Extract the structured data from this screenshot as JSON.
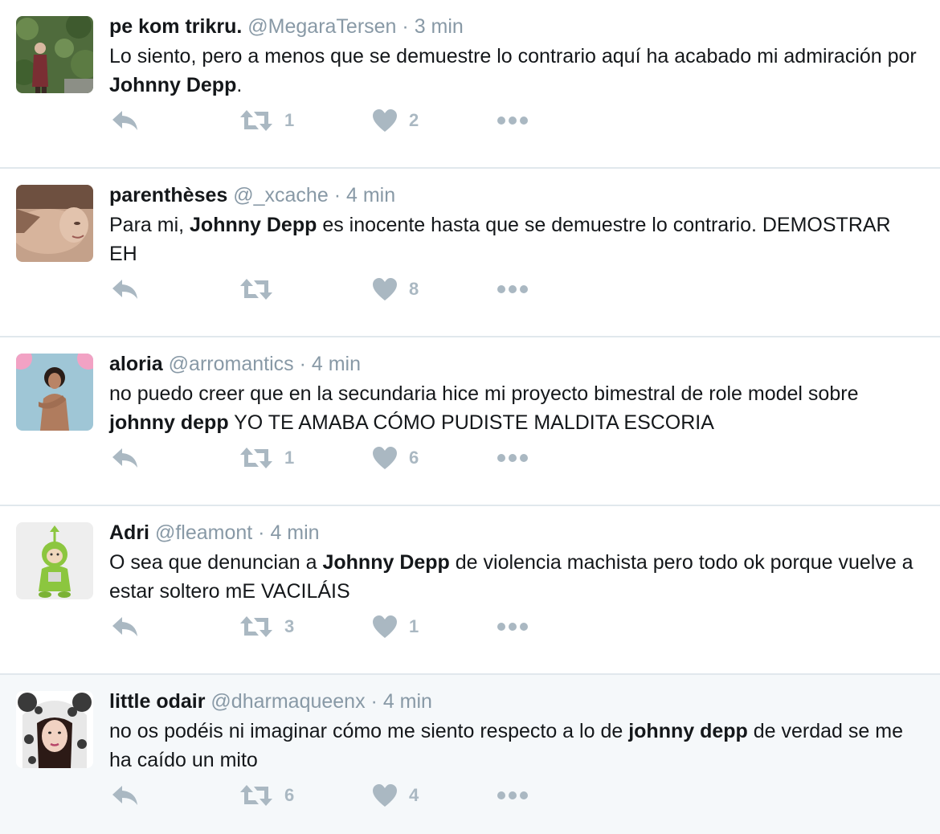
{
  "colors": {
    "icon": "#aab8c2",
    "muted": "#8899a6",
    "text": "#14171a",
    "divider": "#e1e8ed",
    "highlight_bg": "#f5f8fa"
  },
  "icons": {
    "reply": "reply-icon",
    "retweet": "retweet-icon",
    "like": "heart-icon",
    "more": "more-dots-icon"
  },
  "tweets": [
    {
      "name": "pe kom trikru.",
      "handle": "@MegaraTersen",
      "separator": "·",
      "time": "3 min",
      "text_before": "Lo siento, pero a menos que se demuestre lo contrario aquí ha acabado mi admiración por ",
      "text_bold": "Johnny Depp",
      "text_after": ".",
      "retweets": "1",
      "likes": "2"
    },
    {
      "name": "parenthèses",
      "handle": "@_xcache",
      "separator": "·",
      "time": "4 min",
      "text_before": "Para mi, ",
      "text_bold": "Johnny Depp",
      "text_after": " es inocente hasta que se demuestre lo contrario. DEMOSTRAR EH",
      "retweets": "",
      "likes": "8"
    },
    {
      "name": "aloria",
      "handle": "@arromantics",
      "separator": "·",
      "time": "4 min",
      "text_before": "no puedo creer que en la secundaria hice mi proyecto bimestral de role model sobre ",
      "text_bold": "johnny depp",
      "text_after": " YO TE AMABA CÓMO PUDISTE MALDITA ESCORIA",
      "retweets": "1",
      "likes": "6"
    },
    {
      "name": "Adri",
      "handle": "@fleamont",
      "separator": "·",
      "time": "4 min",
      "text_before": "O sea que denuncian a ",
      "text_bold": "Johnny Depp",
      "text_after": " de violencia machista pero todo ok porque vuelve a estar soltero mE VACILÁIS",
      "retweets": "3",
      "likes": "1"
    },
    {
      "name": "little odair",
      "handle": "@dharmaqueenx",
      "separator": "·",
      "time": "4 min",
      "text_before": "no os podéis ni imaginar cómo me siento respecto a lo de ",
      "text_bold": "johnny depp",
      "text_after": " de verdad se me ha caído un mito",
      "retweets": "6",
      "likes": "4"
    }
  ]
}
